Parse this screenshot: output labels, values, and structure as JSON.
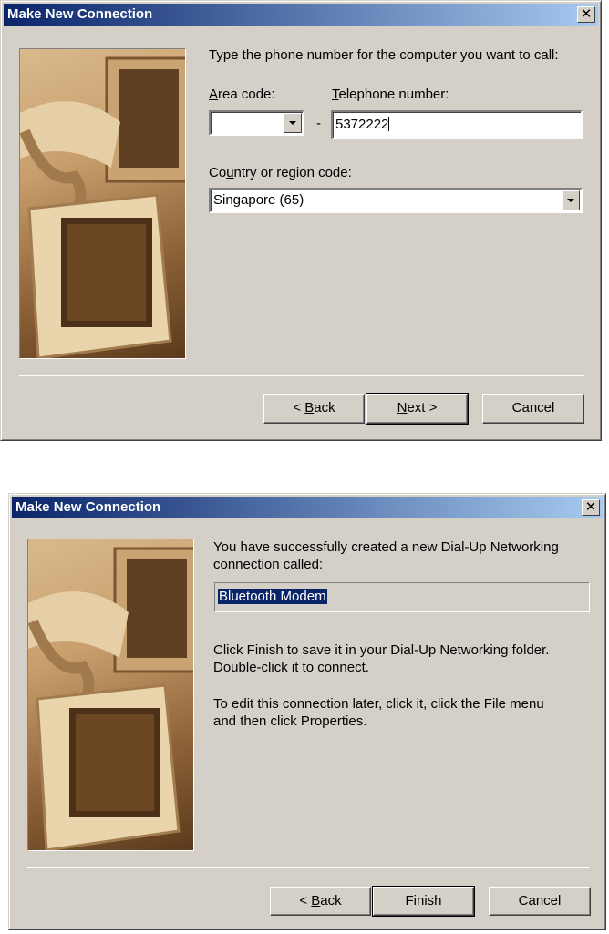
{
  "dialog1": {
    "title": "Make New Connection",
    "close_glyph": "✕",
    "instruction": "Type the phone number for the computer you want to call:",
    "area_code_label": "Area code:",
    "area_code_value": "",
    "dash": "-",
    "phone_label": "Telephone number:",
    "phone_value": "5372222",
    "country_label": "Country or region code:",
    "country_value": "Singapore (65)",
    "buttons": {
      "back": "< Back",
      "next": "Next >",
      "cancel": "Cancel"
    }
  },
  "dialog2": {
    "title": "Make New Connection",
    "close_glyph": "✕",
    "success_line1": "You have successfully created a new Dial-Up Networking",
    "success_line2": "connection called:",
    "connection_name": "Bluetooth Modem",
    "finish_line1": "Click Finish to save it in your Dial-Up Networking folder.",
    "finish_line2": "Double-click it to connect.",
    "edit_line1": "To edit this connection later, click it, click the File menu",
    "edit_line2": "and then click Properties.",
    "buttons": {
      "back": "< Back",
      "finish": "Finish",
      "cancel": "Cancel"
    }
  },
  "icons": {
    "illustration": "computer-and-telephone-illustration",
    "close": "close-icon",
    "dropdown": "chevron-down-icon"
  },
  "colors": {
    "titlebar_start": "#0a246a",
    "titlebar_end": "#a6caf0",
    "dialog_face": "#d4d0c8",
    "selection": "#0a246a"
  }
}
